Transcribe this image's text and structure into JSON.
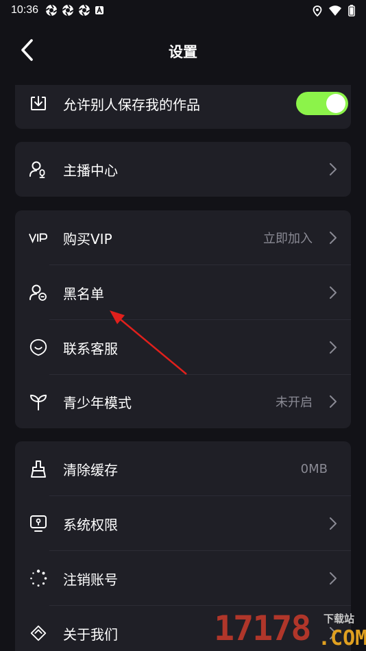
{
  "status_bar": {
    "time": "10:36",
    "left_icons": [
      "aperture-icon",
      "aperture-icon",
      "aperture-icon",
      "a-badge-icon"
    ],
    "right_icons": [
      "location-icon",
      "wifi-icon",
      "battery-icon"
    ]
  },
  "header": {
    "title": "设置",
    "back_icon": "chevron-left-icon"
  },
  "sections": {
    "save": {
      "rows": [
        {
          "label": "允许别人保存我的作品",
          "icon": "download-icon",
          "toggle_on": true
        }
      ]
    },
    "host": {
      "rows": [
        {
          "label": "主播中心",
          "icon": "host-center-icon"
        }
      ]
    },
    "account": {
      "rows": [
        {
          "label": "购买VIP",
          "icon": "vip-icon",
          "value": "立即加入"
        },
        {
          "label": "黑名单",
          "icon": "blacklist-icon"
        },
        {
          "label": "联系客服",
          "icon": "customer-service-icon"
        },
        {
          "label": "青少年模式",
          "icon": "sprout-icon",
          "value": "未开启"
        }
      ]
    },
    "system": {
      "rows": [
        {
          "label": "清除缓存",
          "icon": "broom-icon",
          "value": "0MB"
        },
        {
          "label": "系统权限",
          "icon": "permission-icon"
        },
        {
          "label": "注销账号",
          "icon": "loading-dots-icon"
        },
        {
          "label": "关于我们",
          "icon": "about-icon"
        }
      ]
    }
  },
  "watermark": {
    "number": "17178",
    "sub": "下载站",
    "domain": ".COM"
  },
  "colors": {
    "background": "#121217",
    "card": "#1f1f26",
    "toggle_on": "#8cf34a",
    "secondary_text": "#8a8a94",
    "annotation_arrow": "#e0201c"
  }
}
